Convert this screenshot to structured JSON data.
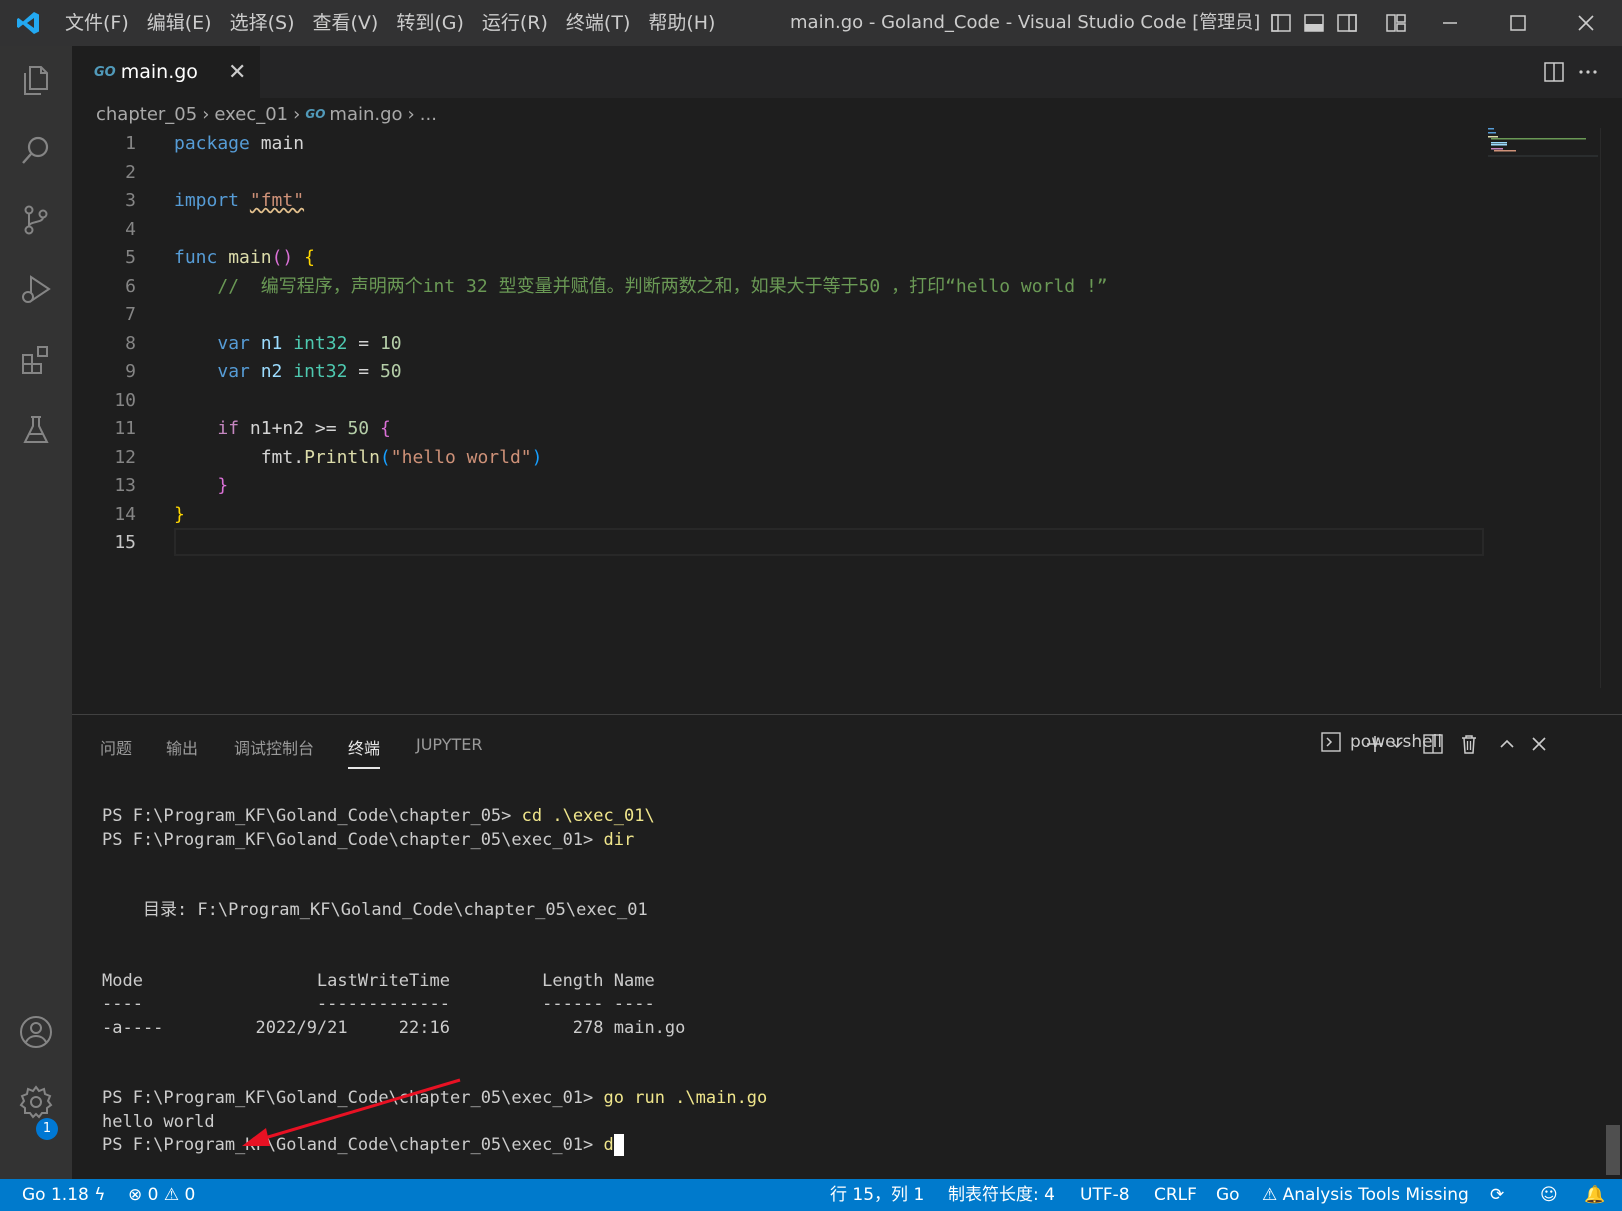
{
  "titlebar": {
    "menus": [
      "文件(F)",
      "编辑(E)",
      "选择(S)",
      "查看(V)",
      "转到(G)",
      "运行(R)",
      "终端(T)",
      "帮助(H)"
    ],
    "window_title": "main.go - Goland_Code - Visual Studio Code [管理员]"
  },
  "activitybar": {
    "icons": [
      "explorer-icon",
      "search-icon",
      "source-control-icon",
      "run-debug-icon",
      "extensions-icon",
      "testing-icon",
      "account-icon",
      "settings-gear-icon"
    ],
    "account_badge": "1"
  },
  "editor": {
    "tab": {
      "icon_text": "GO",
      "label": "main.go",
      "close": "✕"
    },
    "breadcrumb": [
      "chapter_05",
      "exec_01",
      "main.go",
      "..."
    ],
    "lines": [
      "1",
      "2",
      "3",
      "4",
      "5",
      "6",
      "7",
      "8",
      "9",
      "10",
      "11",
      "12",
      "13",
      "14",
      "15"
    ],
    "active_line": "15",
    "code": {
      "l1_kw": "package",
      "l1_name": "main",
      "l3_kw": "import",
      "l3_str": "\"fmt\"",
      "l5_kw": "func",
      "l5_fn": "main",
      "l5_paren": "()",
      "l5_brace": "{",
      "l6_cmt": "//  编写程序，声明两个int 32 型变量并赋值。判断两数之和，如果大于等于50 ，打印“hello world !”",
      "l8_kw": "var",
      "l8_name": "n1",
      "l8_type": "int32",
      "l8_op": "=",
      "l8_num": "10",
      "l9_kw": "var",
      "l9_name": "n2",
      "l9_type": "int32",
      "l9_op": "=",
      "l9_num": "50",
      "l11_kw": "if",
      "l11_expr": "n1+n2 >=",
      "l11_num": "50",
      "l11_brace": "{",
      "l12_pkg": "fmt.",
      "l12_fn": "Println",
      "l12_open": "(",
      "l12_str": "\"hello world\"",
      "l12_close": ")",
      "l13_brace": "}",
      "l14_brace": "}"
    }
  },
  "panel": {
    "tabs": [
      "问题",
      "输出",
      "调试控制台",
      "终端",
      "JUPYTER"
    ],
    "active_tab": "终端",
    "terminal_name": "powershell",
    "terminal": {
      "p1": "PS F:\\Program_KF\\Goland_Code\\chapter_05> ",
      "c1": "cd .\\exec_01\\",
      "p2": "PS F:\\Program_KF\\Goland_Code\\chapter_05\\exec_01> ",
      "c2": "dir",
      "dir_line": "    目录: F:\\Program_KF\\Goland_Code\\chapter_05\\exec_01",
      "hdr": "Mode                 LastWriteTime         Length Name",
      "sep": "----                 -------------         ------ ----",
      "row": "-a----         2022/9/21     22:16            278 main.go",
      "p3": "PS F:\\Program_KF\\Goland_Code\\chapter_05\\exec_01> ",
      "c3": "go run .\\main.go",
      "out": "hello world",
      "p4": "PS F:\\Program_KF\\Goland_Code\\chapter_05\\exec_01> ",
      "c4": "d"
    }
  },
  "statusbar": {
    "go_version": "Go 1.18",
    "errors": "0",
    "warnings": "0",
    "position": "行 15，列 1",
    "tab_size": "制表符长度: 4",
    "encoding": "UTF-8",
    "eol": "CRLF",
    "language": "Go",
    "analysis": "Analysis Tools Missing"
  },
  "colors": {
    "accent": "#007acc",
    "arrow": "#e81123"
  }
}
